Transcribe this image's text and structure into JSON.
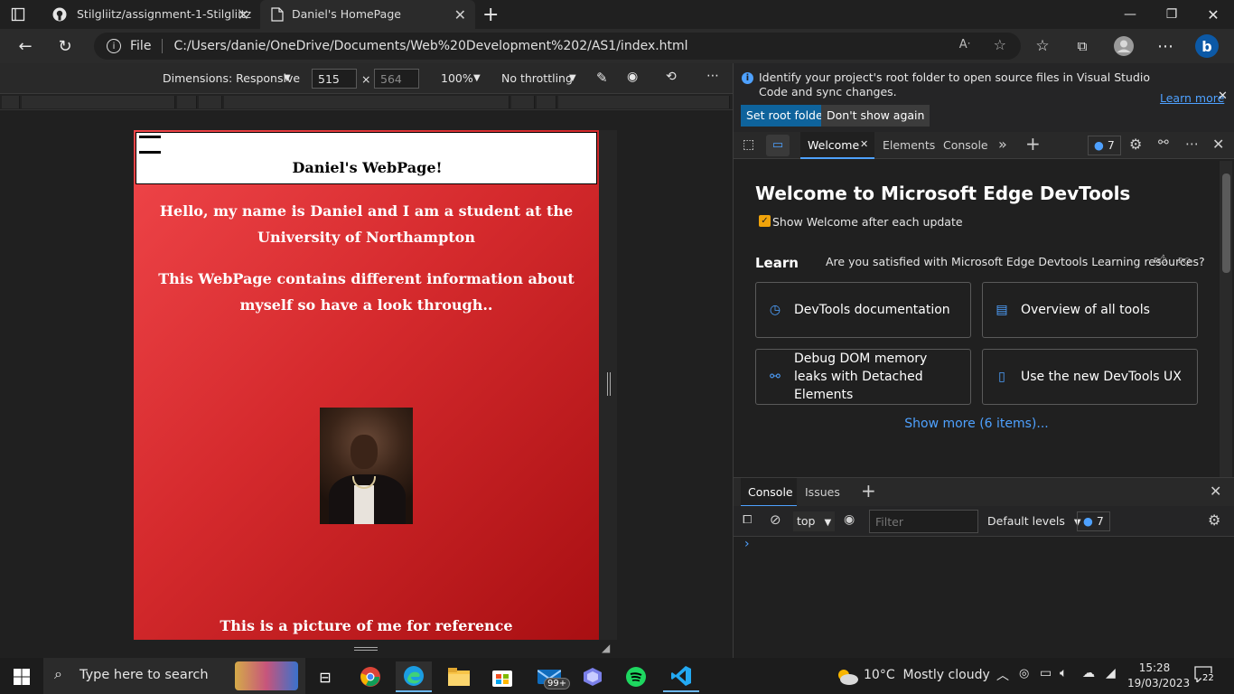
{
  "browser": {
    "tabs": [
      {
        "label": "Stilgliitz/assignment-1-Stilgliitz",
        "icon": "github-icon"
      },
      {
        "label": "Daniel's HomePage",
        "icon": "page-icon"
      }
    ],
    "address": {
      "scheme": "File",
      "url": "C:/Users/danie/OneDrive/Documents/Web%20Development%202/AS1/index.html"
    }
  },
  "device_toolbar": {
    "dimensions_label": "Dimensions: Responsive",
    "width": "515",
    "height": "564",
    "times": "×",
    "zoom": "100%",
    "throttling": "No throttling"
  },
  "webpage": {
    "title": "Daniel's WebPage!",
    "intro": "Hello, my name is Daniel and I am a student at the University of Northampton",
    "info": "This WebPage contains different information about myself so have a look through..",
    "caption": "This is a picture of me for reference"
  },
  "devtools": {
    "info_message": "Identify your project's root folder to open source files in Visual Studio Code and sync changes.",
    "learn_more": "Learn more",
    "set_root": "Set root folder",
    "dont_show": "Don't show again",
    "tabs": {
      "welcome": "Welcome",
      "elements": "Elements",
      "console": "Console"
    },
    "issues_count": "7",
    "welcome_title": "Welcome to Microsoft Edge DevTools",
    "show_welcome": "Show Welcome after each update",
    "learn_heading": "Learn",
    "satisfied_question": "Are you satisfied with Microsoft Edge Devtools Learning resources?",
    "cards": [
      "DevTools documentation",
      "Overview of all tools",
      "Debug DOM memory leaks with Detached Elements",
      "Use the new DevTools UX"
    ],
    "show_more": "Show more (6 items)...",
    "drawer_tabs": {
      "console": "Console",
      "issues": "Issues"
    },
    "context": "top",
    "filter_placeholder": "Filter",
    "levels": "Default levels",
    "prompt": "›"
  },
  "taskbar": {
    "search_placeholder": "Type here to search",
    "weather": "10°C  Mostly cloudy",
    "mail_badge": "99+",
    "time": "15:28",
    "date": "19/03/2023",
    "notifications": "22"
  },
  "colors": {
    "accent": "#0078d4",
    "page_red_light": "#f0464a",
    "page_red_dark": "#a80f12",
    "link": "#4ea1ff"
  }
}
